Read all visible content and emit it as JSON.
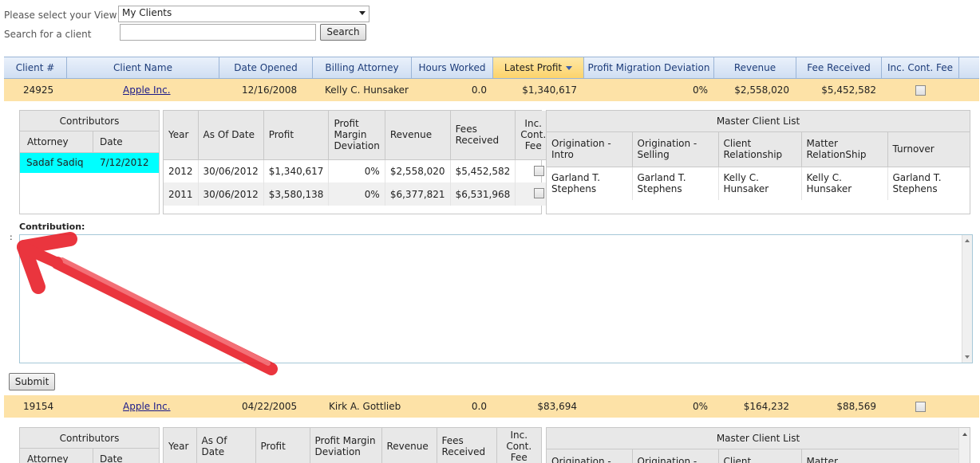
{
  "filters": {
    "view_label": "Please select your View",
    "view_value": "My Clients",
    "search_label": "Search for a client",
    "search_value": "",
    "search_button": "Search"
  },
  "grid": {
    "headers": [
      "Client #",
      "Client Name",
      "Date Opened",
      "Billing Attorney",
      "Hours Worked",
      "Latest Profit",
      "Profit Migration Deviation",
      "Revenue",
      "Fee Received",
      "Inc. Cont. Fee"
    ],
    "sorted_column": "Latest Profit",
    "rows": [
      {
        "client_no": "24925",
        "client_name": "Apple Inc.",
        "date_opened": "12/16/2008",
        "billing_attorney": "Kelly C. Hunsaker",
        "hours_worked": "0.0",
        "latest_profit": "$1,340,617",
        "profit_migration": "0%",
        "revenue": "$2,558,020",
        "fee_received": "$5,452,582"
      },
      {
        "client_no": "19154",
        "client_name": "Apple Inc.",
        "date_opened": "04/22/2005",
        "billing_attorney": "Kirk A. Gottlieb",
        "hours_worked": "0.0",
        "latest_profit": "$83,694",
        "profit_migration": "0%",
        "revenue": "$164,232",
        "fee_received": "$88,569"
      }
    ]
  },
  "detail1": {
    "contributors": {
      "title": "Contributors",
      "headers": [
        "Attorney",
        "Date"
      ],
      "rows": [
        {
          "attorney": "Sadaf Sadiq",
          "date": "7/12/2012"
        }
      ]
    },
    "yearly": {
      "headers": [
        "Year",
        "As Of Date",
        "Profit",
        "Profit Margin Deviation",
        "Revenue",
        "Fees Received",
        "Inc. Cont. Fee"
      ],
      "rows": [
        {
          "year": "2012",
          "as_of": "30/06/2012",
          "profit": "$1,340,617",
          "deviation": "0%",
          "revenue": "$2,558,020",
          "fees": "$5,452,582"
        },
        {
          "year": "2011",
          "as_of": "30/06/2012",
          "profit": "$3,580,138",
          "deviation": "0%",
          "revenue": "$6,377,821",
          "fees": "$6,531,968"
        }
      ]
    },
    "master": {
      "title": "Master Client List",
      "headers": [
        "Origination - Intro",
        "Origination - Selling",
        "Client Relationship",
        "Matter RelationShip",
        "Turnover"
      ],
      "values": [
        "Garland T. Stephens",
        "Garland T. Stephens",
        "Kelly C. Hunsaker",
        "Kelly C. Hunsaker",
        "Garland T. Stephens"
      ]
    },
    "contribution_label": "Contribution:",
    "contribution_value": "",
    "colon": ":",
    "submit": "Submit"
  },
  "detail2": {
    "contributors": {
      "title": "Contributors",
      "headers": [
        "Attorney",
        "Date"
      ]
    },
    "yearly": {
      "headers": [
        "Year",
        "As Of Date",
        "Profit",
        "Profit Margin Deviation",
        "Revenue",
        "Fees Received",
        "Inc. Cont. Fee"
      ]
    },
    "master": {
      "title": "Master Client List",
      "headers": [
        "Origination -",
        "Origination -",
        "Client",
        "Matter"
      ]
    }
  },
  "annotation": {
    "type": "red-arrow",
    "color": "#e8202a"
  }
}
